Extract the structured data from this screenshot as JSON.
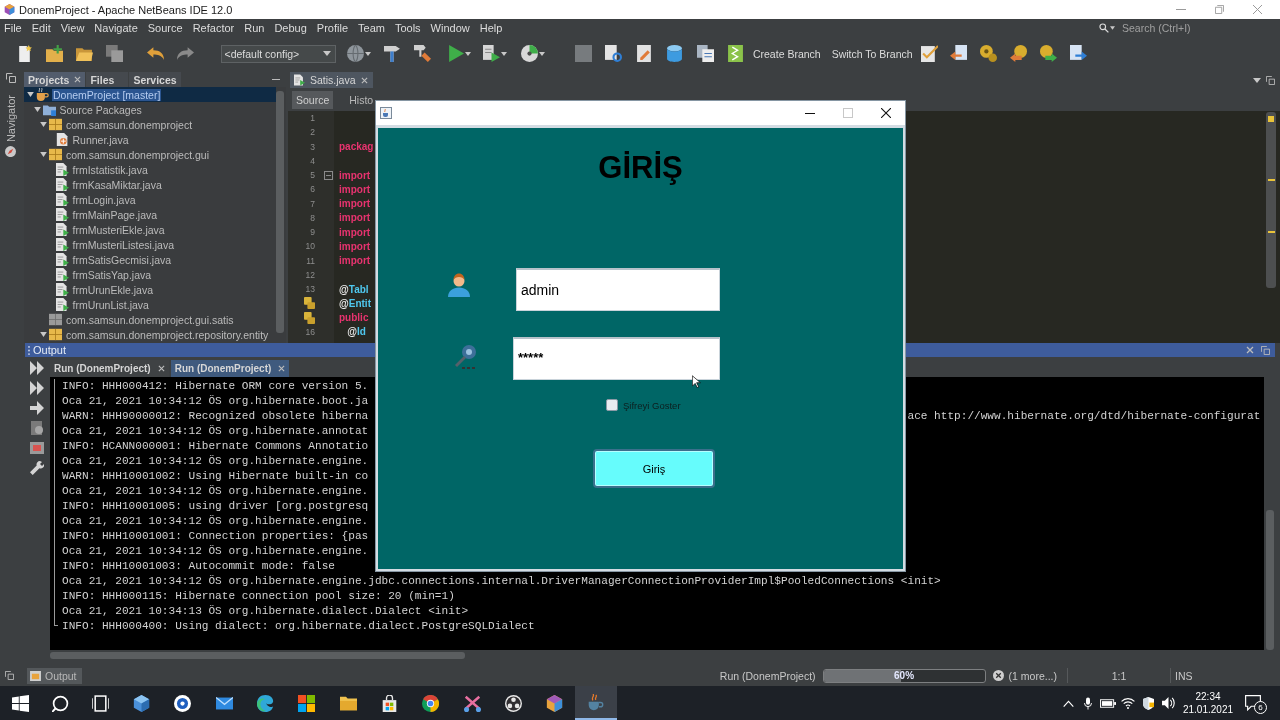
{
  "window": {
    "title": "DonemProject - Apache NetBeans IDE 12.0"
  },
  "menu": [
    "File",
    "Edit",
    "View",
    "Navigate",
    "Source",
    "Refactor",
    "Run",
    "Debug",
    "Profile",
    "Team",
    "Tools",
    "Window",
    "Help"
  ],
  "search": {
    "placeholder": "Search (Ctrl+I)"
  },
  "toolbar": {
    "config": "<default config>",
    "text_buttons": [
      "Create Branch",
      "Switch To Branch"
    ]
  },
  "navigator": {
    "label": "Navigator"
  },
  "projects_panel": {
    "tabs": [
      {
        "label": "Projects",
        "selected": true
      },
      {
        "label": "Files",
        "selected": false
      },
      {
        "label": "Services",
        "selected": false
      }
    ],
    "tree": [
      {
        "kind": "project",
        "label": "DonemProject [master]",
        "selected": true,
        "expanded": true,
        "children": [
          {
            "kind": "source-root",
            "label": "Source Packages",
            "selected": false,
            "expanded": true,
            "children": [
              {
                "kind": "package",
                "label": "com.samsun.donemproject",
                "selected": false,
                "expanded": true,
                "children": [
                  {
                    "kind": "class",
                    "label": "Runner.java",
                    "selected": false
                  }
                ]
              },
              {
                "kind": "package",
                "label": "com.samsun.donemproject.gui",
                "selected": false,
                "expanded": true,
                "children": [
                  {
                    "kind": "form",
                    "label": "frmIstatistik.java",
                    "selected": false
                  },
                  {
                    "kind": "form",
                    "label": "frmKasaMiktar.java",
                    "selected": false
                  },
                  {
                    "kind": "form",
                    "label": "frmLogin.java",
                    "selected": false
                  },
                  {
                    "kind": "form",
                    "label": "frmMainPage.java",
                    "selected": false
                  },
                  {
                    "kind": "form",
                    "label": "frmMusteriEkle.java",
                    "selected": false
                  },
                  {
                    "kind": "form",
                    "label": "frmMusteriListesi.java",
                    "selected": false
                  },
                  {
                    "kind": "form",
                    "label": "frmSatisGecmisi.java",
                    "selected": false
                  },
                  {
                    "kind": "form",
                    "label": "frmSatisYap.java",
                    "selected": false
                  },
                  {
                    "kind": "form",
                    "label": "frmUrunEkle.java",
                    "selected": false
                  },
                  {
                    "kind": "form",
                    "label": "frmUrunList.java",
                    "selected": false
                  }
                ]
              },
              {
                "kind": "empty-package",
                "label": "com.samsun.donemproject.gui.satis",
                "selected": false
              },
              {
                "kind": "package",
                "label": "com.samsun.donemproject.repository.entity",
                "selected": false,
                "expanded": true
              }
            ]
          }
        ]
      }
    ]
  },
  "editor": {
    "tabs": [
      {
        "label": "Satis.java",
        "selected": true
      }
    ],
    "views": [
      {
        "label": "Source",
        "selected": true
      },
      {
        "label": "Histo",
        "selected": false
      }
    ],
    "lines": [
      {
        "number": "1",
        "hint": false,
        "fold": false
      },
      {
        "number": "2",
        "hint": false,
        "fold": false
      },
      {
        "number": "3",
        "hint": false,
        "fold": false,
        "tokens": [
          {
            "kind": "keyword",
            "text": "packag"
          }
        ]
      },
      {
        "number": "4",
        "hint": false,
        "fold": false
      },
      {
        "number": "5",
        "hint": false,
        "fold": true,
        "tokens": [
          {
            "kind": "keyword",
            "text": "import"
          }
        ]
      },
      {
        "number": "6",
        "hint": false,
        "fold": false,
        "tokens": [
          {
            "kind": "keyword",
            "text": "import"
          }
        ]
      },
      {
        "number": "7",
        "hint": false,
        "fold": false,
        "tokens": [
          {
            "kind": "keyword",
            "text": "import"
          }
        ]
      },
      {
        "number": "8",
        "hint": false,
        "fold": false,
        "tokens": [
          {
            "kind": "keyword",
            "text": "import"
          }
        ]
      },
      {
        "number": "9",
        "hint": false,
        "fold": false,
        "tokens": [
          {
            "kind": "keyword",
            "text": "import"
          }
        ]
      },
      {
        "number": "10",
        "hint": false,
        "fold": false,
        "tokens": [
          {
            "kind": "keyword",
            "text": "import"
          }
        ]
      },
      {
        "number": "11",
        "hint": false,
        "fold": false,
        "tokens": [
          {
            "kind": "keyword",
            "text": "import"
          }
        ]
      },
      {
        "number": "12",
        "hint": false,
        "fold": false
      },
      {
        "number": "13",
        "hint": false,
        "fold": false,
        "tokens": [
          {
            "kind": "at",
            "text": "@"
          },
          {
            "kind": "annotation",
            "text": "Tabl"
          }
        ]
      },
      {
        "hint": true,
        "fold": false,
        "tokens": [
          {
            "kind": "at",
            "text": "@"
          },
          {
            "kind": "annotation",
            "text": "Entit"
          }
        ]
      },
      {
        "hint": true,
        "fold": false,
        "tokens": [
          {
            "kind": "keyword",
            "text": "public"
          }
        ]
      },
      {
        "number": "16",
        "hint": false,
        "fold": false,
        "tokens": [
          {
            "kind": "at",
            "text": "   @"
          },
          {
            "kind": "annotation",
            "text": "Id"
          }
        ]
      }
    ]
  },
  "dialog": {
    "heading": "GİRİŞ",
    "window_buttons": [
      {
        "kind": "minimize",
        "disabled": false
      },
      {
        "kind": "maximize",
        "disabled": true
      },
      {
        "kind": "close",
        "disabled": false
      }
    ],
    "username": {
      "value": "admin"
    },
    "password": {
      "value": "*****"
    },
    "show_password": {
      "label": "Şifreyi Goster",
      "checked": false
    },
    "submit": "Giriş"
  },
  "output": {
    "title": "Output",
    "tabs": [
      {
        "label": "Run (DonemProject)",
        "selected": false
      },
      {
        "label": "Run (DonemProject)",
        "selected": true
      }
    ],
    "lines": [
      {
        "text": "INFO: HHH000412: Hibernate ORM core version 5."
      },
      {
        "text": "Oca 21, 2021 10:34:12 ÖS org.hibernate.boot.ja"
      },
      {
        "text": "WARN: HHH90000012: Recognized obsolete hiberna",
        "text_after": "ace http://www.hibernate.org/dtd/hibernate-configurat"
      },
      {
        "text": "Oca 21, 2021 10:34:12 ÖS org.hibernate.annotat"
      },
      {
        "text": "INFO: HCANN000001: Hibernate Commons Annotatio"
      },
      {
        "text": "Oca 21, 2021 10:34:12 ÖS org.hibernate.engine."
      },
      {
        "text": "WARN: HHH10001002: Using Hibernate built-in co"
      },
      {
        "text": "Oca 21, 2021 10:34:12 ÖS org.hibernate.engine."
      },
      {
        "text": "INFO: HHH10001005: using driver [org.postgresq"
      },
      {
        "text": "Oca 21, 2021 10:34:12 ÖS org.hibernate.engine."
      },
      {
        "text": "INFO: HHH10001001: Connection properties: {pas"
      },
      {
        "text": "Oca 21, 2021 10:34:12 ÖS org.hibernate.engine."
      },
      {
        "text": "INFO: HHH10001003: Autocommit mode: false"
      },
      {
        "text": "Oca 21, 2021 10:34:12 ÖS org.hibernate.engine.jdbc.connections.internal.DriverManagerConnectionProviderImpl$PooledConnections <init>"
      },
      {
        "text": "INFO: HHH000115: Hibernate connection pool size: 20 (min=1)"
      },
      {
        "text": "Oca 21, 2021 10:34:13 ÖS org.hibernate.dialect.Dialect <init>"
      },
      {
        "text": "INFO: HHH000400: Using dialect: org.hibernate.dialect.PostgreSQLDialect"
      }
    ]
  },
  "status_bar": {
    "output_button": "Output",
    "task": "Run (DonemProject)",
    "progress": {
      "level": 0.48,
      "reading": "60%"
    },
    "more": "(1 more...)",
    "position": "1:1",
    "mode": "INS"
  },
  "taskbar": {
    "apps": [
      {
        "kind": "cube",
        "selected": false
      },
      {
        "kind": "disc",
        "selected": false
      },
      {
        "kind": "mail",
        "selected": false
      },
      {
        "kind": "wave",
        "selected": false
      },
      {
        "kind": "tiles",
        "selected": false
      },
      {
        "kind": "folder",
        "selected": false
      },
      {
        "kind": "bag",
        "selected": false
      },
      {
        "kind": "ring",
        "selected": false
      },
      {
        "kind": "snip",
        "selected": false
      },
      {
        "kind": "lens",
        "selected": false
      },
      {
        "kind": "box",
        "selected": false
      },
      {
        "kind": "cup",
        "selected": true
      }
    ],
    "time": "22:34",
    "date": "21.01.2021",
    "notifications": "6"
  }
}
